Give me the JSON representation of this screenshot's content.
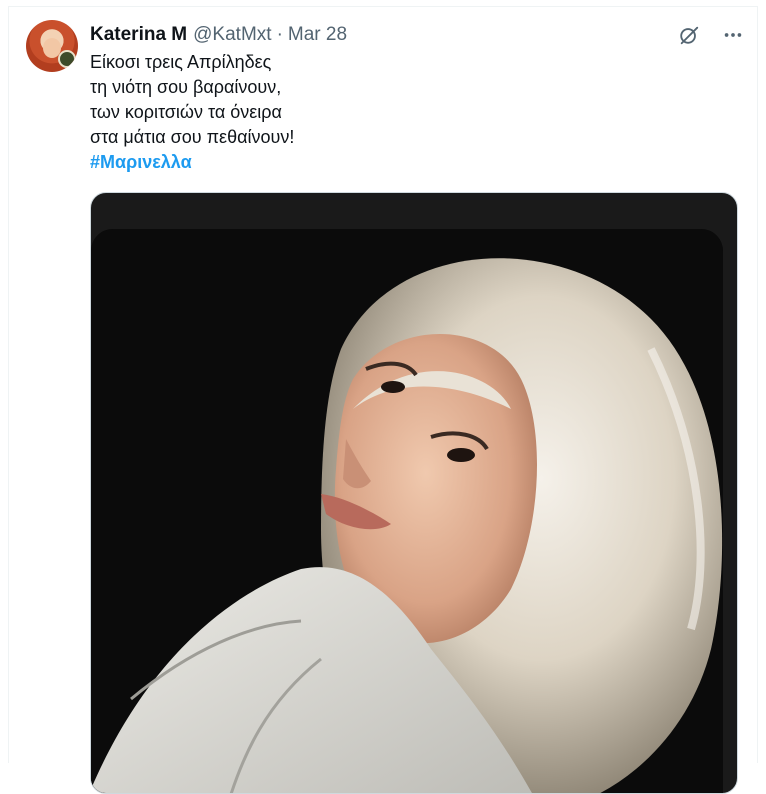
{
  "tweet": {
    "author_name": "Katerina M",
    "handle": "@KatMxt",
    "separator": "·",
    "date": "Mar 28",
    "lines": [
      "Είκοσι τρεις Απρίληδες",
      "τη νιότη σου βαραίνουν,",
      "των κοριτσιών τα όνειρα",
      "στα μάτια σου πεθαίνουν!"
    ],
    "hashtag": "#Μαρινελλα"
  },
  "icons": {
    "grok": "grok-icon",
    "more": "more-icon"
  },
  "colors": {
    "link": "#1d9bf0",
    "secondary_text": "#536471",
    "primary_text": "#0f1419"
  }
}
